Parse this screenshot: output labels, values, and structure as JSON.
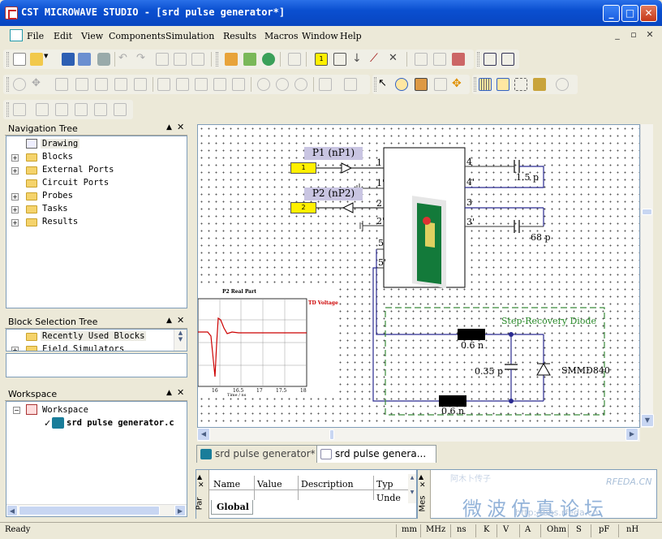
{
  "window": {
    "title": "CST MICROWAVE STUDIO - [srd pulse generator*]"
  },
  "menu": [
    "File",
    "Edit",
    "View",
    "Components",
    "Simulation",
    "Results",
    "Macros",
    "Window",
    "Help"
  ],
  "nav_tree": {
    "title": "Navigation Tree",
    "items": [
      "Drawing",
      "Blocks",
      "External Ports",
      "Circuit Ports",
      "Probes",
      "Tasks",
      "Results"
    ]
  },
  "block_tree": {
    "title": "Block Selection Tree",
    "items": [
      "Recently Used Blocks",
      "Field Simulators"
    ]
  },
  "workspace": {
    "title": "Workspace",
    "root": "Workspace",
    "doc": "srd pulse generator.c"
  },
  "schematic": {
    "port1": "P1 (nP1)",
    "port2": "P2 (nP2)",
    "port1_num": "1",
    "port2_num": "2",
    "pins_left": [
      "1",
      "1'",
      "2",
      "2'",
      "5",
      "5'"
    ],
    "pins_right": [
      "4",
      "4'",
      "3",
      "3'"
    ],
    "cap1": "1.5 p",
    "cap2": "68 p",
    "diode_group": "Step-Recovery Diode",
    "ind1": "0.6 n",
    "cap3": "0.35 p",
    "diode": "SMMD840",
    "ind2": "0.6 n",
    "plot_title": "P2 Real Part",
    "plot_legend": "TD Voltage",
    "plot_xticks": [
      "16",
      "16.5",
      "17",
      "17.5",
      "18"
    ],
    "plot_xlabel": "Time / ns"
  },
  "doc_tabs": [
    "srd pulse generator*",
    "srd pulse genera..."
  ],
  "params": {
    "headers": [
      "Name",
      "Value",
      "Description",
      "Typ"
    ],
    "row_type": "Unde",
    "side_tab": "Par",
    "tab": "Global"
  },
  "messages": {
    "side_tab": "Mes"
  },
  "watermark": {
    "text1": "微波仿真论坛",
    "text2": "RFEDA.CN",
    "text3": "http://bbs.rfeda.cn",
    "text4": "阿木卜传子"
  },
  "status": {
    "text": "Ready",
    "units": [
      "mm",
      "MHz",
      "ns",
      "K",
      "V",
      "A",
      "Ohm",
      "S",
      "pF",
      "nH"
    ]
  }
}
